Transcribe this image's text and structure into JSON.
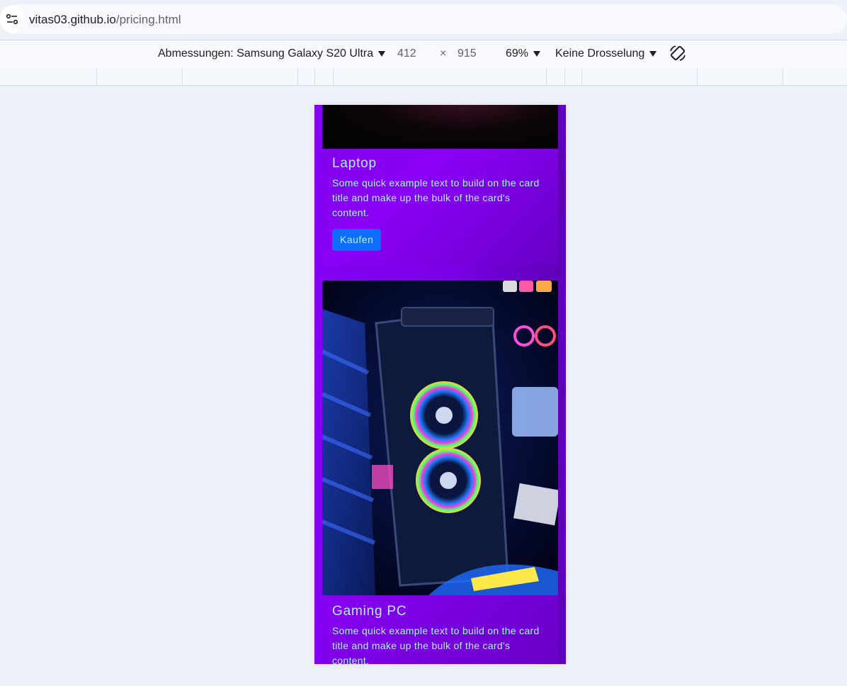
{
  "browser": {
    "url_host": "vitas03.github.io",
    "url_path": "/pricing.html"
  },
  "device_toolbar": {
    "dimensions_label": "Abmessungen: Samsung Galaxy S20 Ultra",
    "width": "412",
    "times": "×",
    "height": "915",
    "zoom": "69%",
    "throttling": "Keine Drosselung"
  },
  "cards": [
    {
      "title": "Laptop",
      "text": "Some quick example text to build on the card title and make up the bulk of the card's content.",
      "button": "Kaufen"
    },
    {
      "title": "Gaming PC",
      "text": "Some quick example text to build on the card title and make up the bulk of the card's content."
    }
  ],
  "colors": {
    "page_background": "#8400f2",
    "card_text": "#aef0ff",
    "button": "#0d6efd"
  }
}
